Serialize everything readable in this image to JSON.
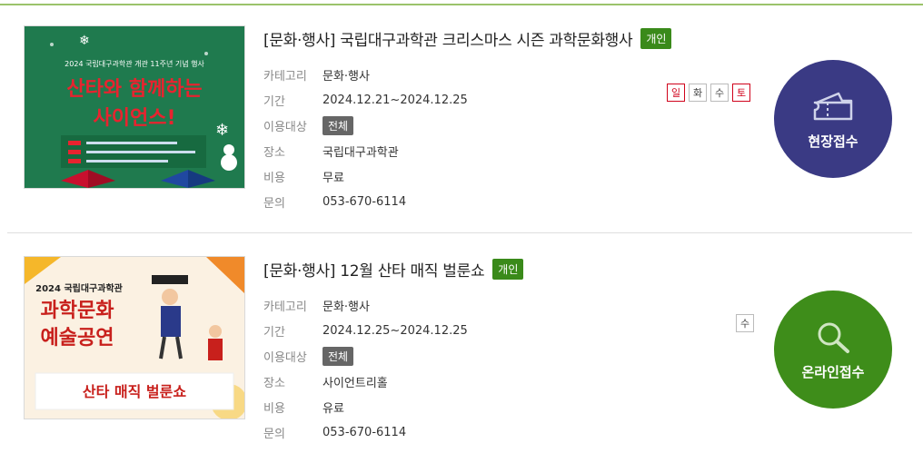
{
  "events": [
    {
      "title": "[문화·행사] 국립대구과학관 크리스마스 시즌 과학문화행사",
      "badge": "개인",
      "labels": {
        "category": "카테고리",
        "period": "기간",
        "audience": "이용대상",
        "place": "장소",
        "fee": "비용",
        "contact": "문의"
      },
      "category": "문화·행사",
      "period": "2024.12.21~2024.12.25",
      "audience": "전체",
      "place": "국립대구과학관",
      "fee": "무료",
      "contact": "053-670-6114",
      "days": [
        "일",
        "화",
        "수",
        "토"
      ],
      "action": "현장접수",
      "action_icon": "ticket-icon",
      "thumb": {
        "line1": "2024 국립대구과학관 개관 11주년 기념 행사",
        "line2": "산타와 함께하는",
        "line3": "사이언스!"
      }
    },
    {
      "title": "[문화·행사] 12월 산타 매직 벌룬쇼",
      "badge": "개인",
      "labels": {
        "category": "카테고리",
        "period": "기간",
        "audience": "이용대상",
        "place": "장소",
        "fee": "비용",
        "contact": "문의"
      },
      "category": "문화·행사",
      "period": "2024.12.25~2024.12.25",
      "audience": "전체",
      "place": "사이언트리홀",
      "fee": "유료",
      "contact": "053-670-6114",
      "days": [
        "수"
      ],
      "action": "온라인접수",
      "action_icon": "search-icon",
      "thumb": {
        "line1": "2024 국립대구과학관",
        "line2": "과학문화",
        "line3": "예술공연",
        "line4": "산타 매직 벌룬쇼"
      }
    }
  ],
  "colors": {
    "onsite": "#3a3a84",
    "online": "#3e8d1a",
    "badge": "#3a8a1a"
  }
}
